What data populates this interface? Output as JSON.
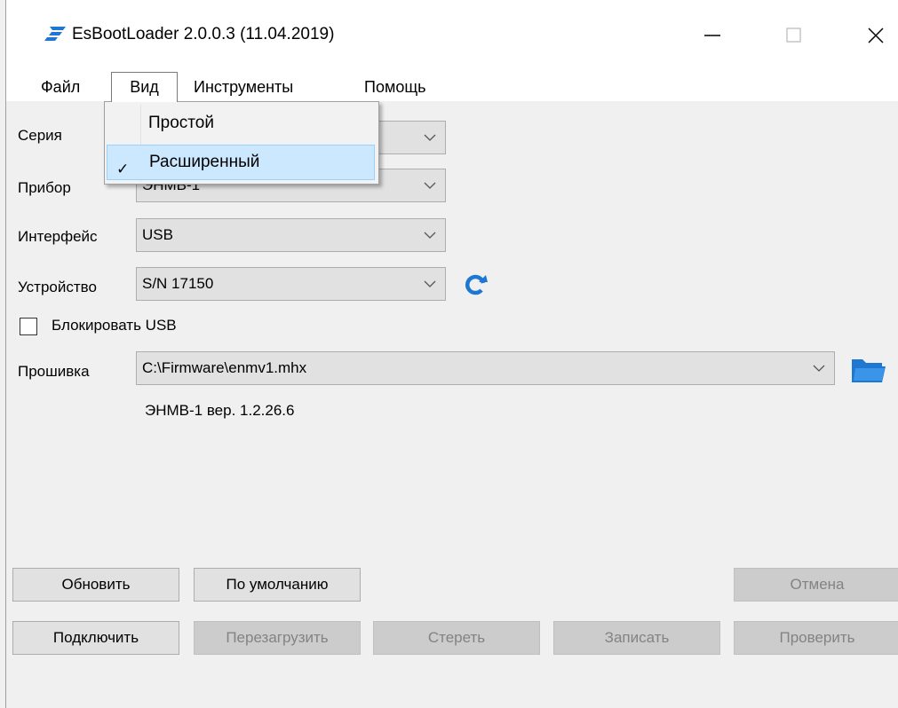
{
  "window": {
    "title": "EsBootLoader 2.0.0.3 (11.04.2019)",
    "icon": "app-logo-icon",
    "controls": [
      "minimize-icon",
      "maximize-icon",
      "close-icon"
    ]
  },
  "menu": {
    "file": "Файл",
    "view": "Вид",
    "tools": "Инструменты",
    "help": "Помощь"
  },
  "view_menu": {
    "items": [
      {
        "label": "Простой",
        "checked": false
      },
      {
        "label": "Расширенный",
        "checked": true
      }
    ],
    "check_glyph": "✓"
  },
  "form": {
    "series_label": "Серия",
    "series_value": "",
    "device_label": "Прибор",
    "device_value": "ЭНМВ-1",
    "interface_label": "Интерфейс",
    "interface_value": "USB",
    "unit_label": "Устройство",
    "unit_value": "S/N 17150",
    "block_usb_label": "Блокировать USB",
    "block_usb_checked": false,
    "firmware_label": "Прошивка",
    "firmware_value": "C:\\Firmware\\enmv1.mhx",
    "firmware_version": "ЭНМВ-1 вер. 1.2.26.6"
  },
  "buttons": {
    "update": "Обновить",
    "default": "По умолчанию",
    "cancel": "Отмена",
    "connect": "Подключить",
    "reboot": "Перезагрузить",
    "erase": "Стереть",
    "write": "Записать",
    "verify": "Проверить"
  },
  "colors": {
    "accent_icon": "#1e78d2",
    "highlight": "#cce8ff",
    "disabled_text": "#838383"
  }
}
